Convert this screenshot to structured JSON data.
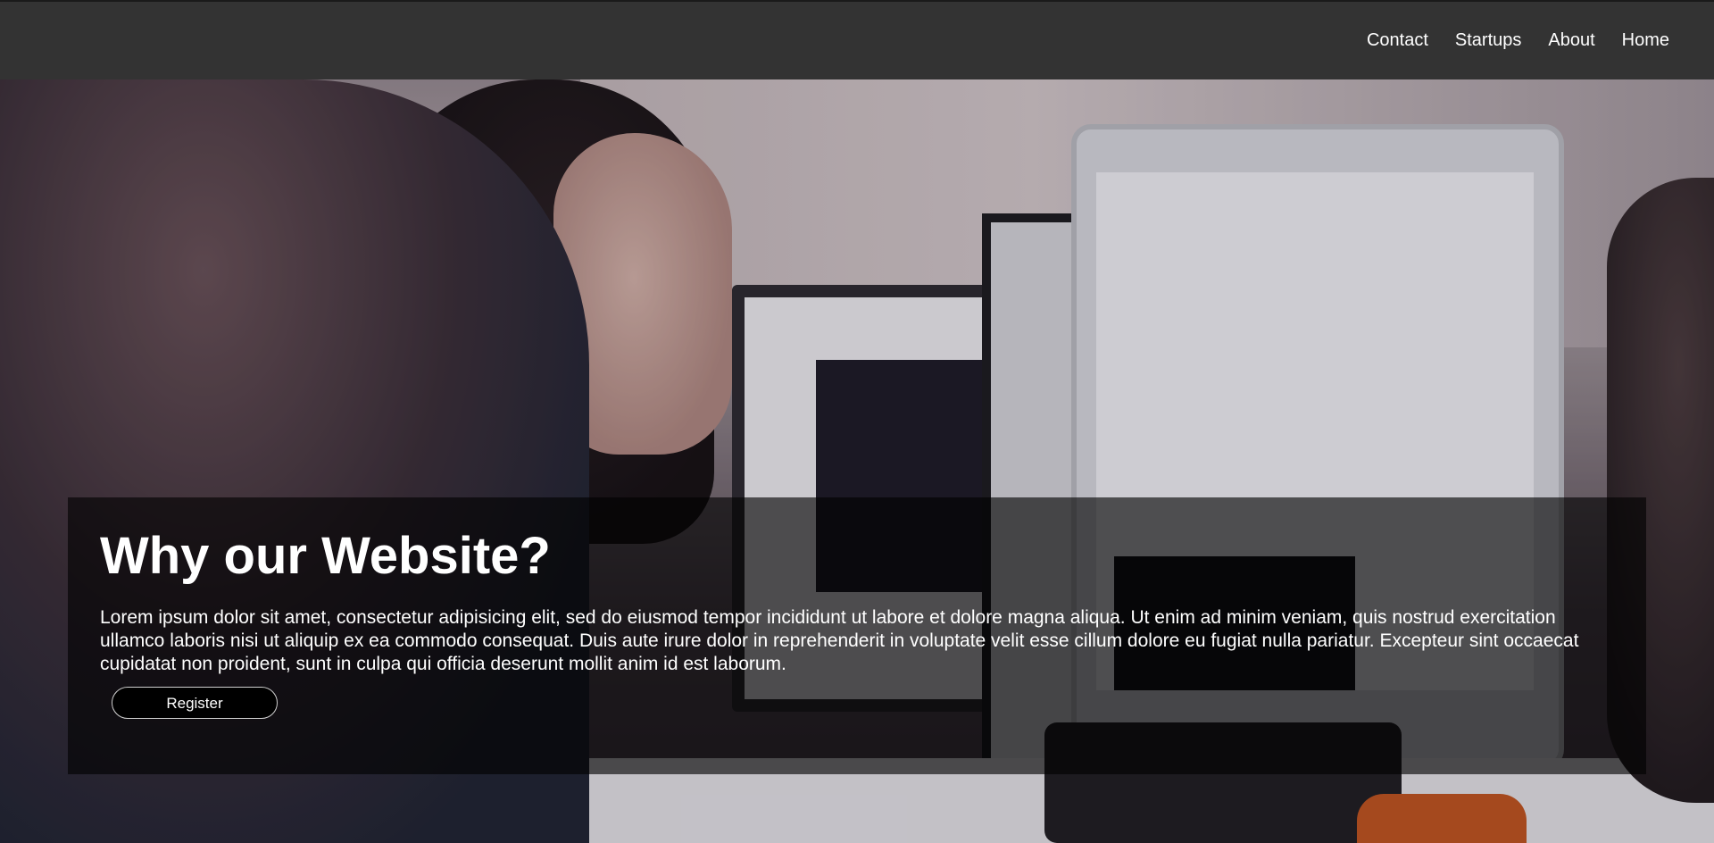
{
  "nav": {
    "links": [
      {
        "label": "Home"
      },
      {
        "label": "About"
      },
      {
        "label": "Startups"
      },
      {
        "label": "Contact"
      }
    ]
  },
  "hero": {
    "image_description": "office photo of people working at computers",
    "title": "Why our Website?",
    "body": "Lorem ipsum dolor sit amet, consectetur adipisicing elit, sed do eiusmod tempor incididunt ut labore et dolore magna aliqua. Ut enim ad minim veniam, quis nostrud exercitation ullamco laboris nisi ut aliquip ex ea commodo consequat. Duis aute irure dolor in reprehenderit in voluptate velit esse cillum dolore eu fugiat nulla pariatur. Excepteur sint occaecat cupidatat non proident, sunt in culpa qui officia deserunt mollit anim id est laborum.",
    "register_label": "Register"
  },
  "colors": {
    "navbar_bg": "#333333",
    "text": "#ffffff",
    "callout_bg": "rgba(0,0,0,0.62)",
    "button_bg": "#000000"
  }
}
